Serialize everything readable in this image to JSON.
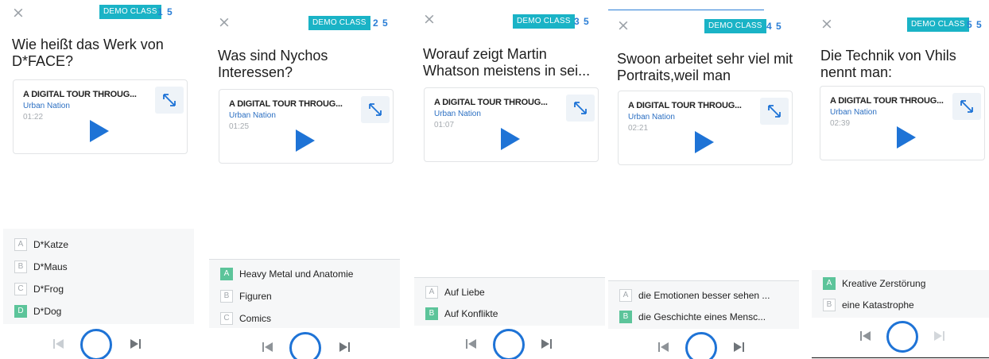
{
  "badge_label": "DEMO CLASS",
  "close_glyph": "×",
  "colors": {
    "accent": "#1e73d6",
    "badge": "#1ab3c6",
    "selected": "#5cc49a",
    "link": "#2b6fc2"
  },
  "icons": {
    "expand": "expand-diagonal-icon",
    "play": "play-icon",
    "prev": "skip-previous-icon",
    "next": "skip-next-icon",
    "record": "record-circle-icon",
    "close": "close-icon"
  },
  "panels": [
    {
      "counter": "1 5",
      "question": "Wie heißt das Werk von D*FACE?",
      "card": {
        "title": "A DIGITAL TOUR THROUG...",
        "subtitle": "Urban Nation",
        "time": "01:22"
      },
      "options": [
        {
          "letter": "A",
          "label": "D*Katze",
          "selected": false
        },
        {
          "letter": "B",
          "label": "D*Maus",
          "selected": false
        },
        {
          "letter": "C",
          "label": "D*Frog",
          "selected": false
        },
        {
          "letter": "D",
          "label": "D*Dog",
          "selected": true
        }
      ]
    },
    {
      "counter": "2 5",
      "question": "Was sind Nychos Interessen?",
      "card": {
        "title": "A DIGITAL TOUR THROUG...",
        "subtitle": "Urban Nation",
        "time": "01:25"
      },
      "options": [
        {
          "letter": "A",
          "label": "Heavy Metal und Anatomie",
          "selected": true
        },
        {
          "letter": "B",
          "label": "Figuren",
          "selected": false
        },
        {
          "letter": "C",
          "label": "Comics",
          "selected": false
        }
      ]
    },
    {
      "counter": "3 5",
      "question": "Worauf zeigt Martin Whatson meistens in sei...",
      "card": {
        "title": "A DIGITAL TOUR THROUG...",
        "subtitle": "Urban Nation",
        "time": "01:07"
      },
      "options": [
        {
          "letter": "A",
          "label": "Auf Liebe",
          "selected": false
        },
        {
          "letter": "B",
          "label": "Auf Konflikte",
          "selected": true
        }
      ]
    },
    {
      "counter": "4 5",
      "question": "Swoon arbeitet sehr viel mit Portraits,weil man",
      "card": {
        "title": "A DIGITAL TOUR THROUG...",
        "subtitle": "Urban Nation",
        "time": "02:21"
      },
      "options": [
        {
          "letter": "A",
          "label": "die Emotionen besser sehen ...",
          "selected": false
        },
        {
          "letter": "B",
          "label": "die Geschichte eines Mensc...",
          "selected": true
        }
      ]
    },
    {
      "counter": "5 5",
      "question": "Die Technik von Vhils nennt man:",
      "card": {
        "title": "A DIGITAL TOUR THROUG...",
        "subtitle": "Urban Nation",
        "time": "02:39"
      },
      "options": [
        {
          "letter": "A",
          "label": "Kreative Zerstörung",
          "selected": true
        },
        {
          "letter": "B",
          "label": "eine Katastrophe",
          "selected": false
        }
      ]
    }
  ]
}
